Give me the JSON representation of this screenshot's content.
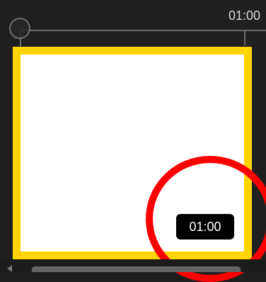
{
  "timeline": {
    "ruler_time": "01:00"
  },
  "clip": {
    "duration": "01:00"
  },
  "colors": {
    "selection_border": "#ffd400",
    "annotation_ring": "#ff0000",
    "background": "#202020"
  },
  "icons": {
    "playhead": "playhead-icon",
    "scroll_left": "chevron-left-icon"
  }
}
